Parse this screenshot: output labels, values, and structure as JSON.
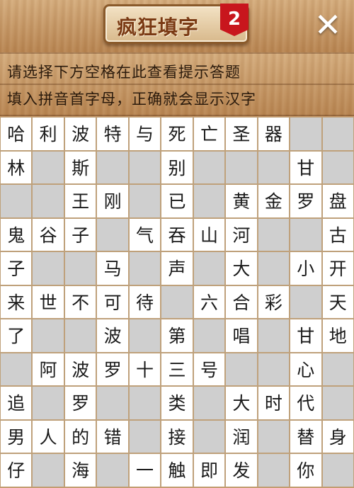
{
  "header": {
    "title": "疯狂填字",
    "level": "2",
    "close_label": "✕"
  },
  "hints": {
    "line1": "请选择下方空格在此查看提示答题",
    "line2": "填入拼音首字母，正确就会显示汉字"
  },
  "colors": {
    "wood": "#c79a6a",
    "badge": "#c8161d",
    "cell_open": "#ffffff",
    "cell_blocked": "#cfcfcf"
  },
  "grid": {
    "rows": [
      [
        "哈",
        "利",
        "波",
        "特",
        "与",
        "死",
        "亡",
        "圣",
        "器",
        "#",
        "#"
      ],
      [
        "林",
        "#",
        "斯",
        "#",
        "#",
        "别",
        "#",
        "#",
        "#",
        "甘",
        "#"
      ],
      [
        "#",
        "#",
        "王",
        "刚",
        "#",
        "已",
        "#",
        "黄",
        "金",
        "罗",
        "盘"
      ],
      [
        "鬼",
        "谷",
        "子",
        "#",
        "气",
        "吞",
        "山",
        "河",
        "#",
        "#",
        "古"
      ],
      [
        "子",
        "#",
        "#",
        "马",
        "#",
        "声",
        "#",
        "大",
        "#",
        "小",
        "开"
      ],
      [
        "来",
        "世",
        "不",
        "可",
        "待",
        "#",
        "六",
        "合",
        "彩",
        "#",
        "天"
      ],
      [
        "了",
        "#",
        "#",
        "波",
        "#",
        "第",
        "#",
        "唱",
        "#",
        "甘",
        "地"
      ],
      [
        "#",
        "阿",
        "波",
        "罗",
        "十",
        "三",
        "号",
        "#",
        "#",
        "心",
        "#"
      ],
      [
        "追",
        "#",
        "罗",
        "#",
        "#",
        "类",
        "#",
        "大",
        "时",
        "代",
        "#"
      ],
      [
        "男",
        "人",
        "的",
        "错",
        "#",
        "接",
        "#",
        "润",
        "#",
        "替",
        "身"
      ],
      [
        "仔",
        "#",
        "海",
        "#",
        "一",
        "触",
        "即",
        "发",
        "#",
        "你",
        "#"
      ]
    ]
  }
}
